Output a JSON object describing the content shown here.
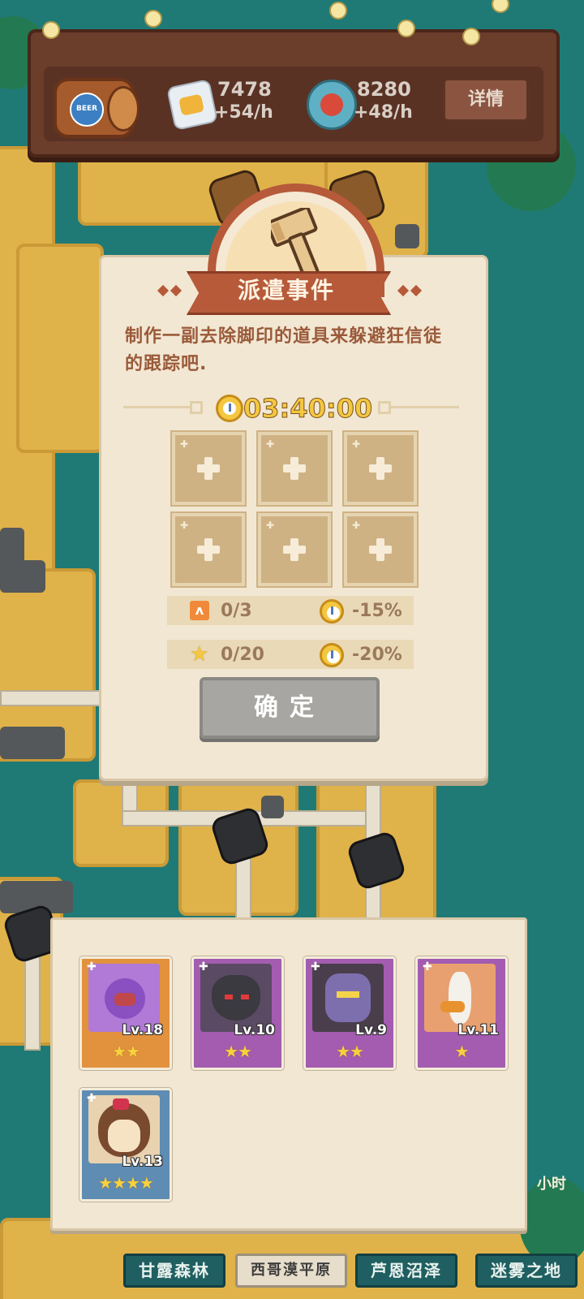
{
  "resources": {
    "beer_logo": "BEER",
    "items": [
      {
        "icon": "crisps-icon",
        "value": "7478",
        "rate": "+54/h"
      },
      {
        "icon": "bottle-cap-icon",
        "value": "8280",
        "rate": "+48/h"
      }
    ],
    "detail_label": "详情"
  },
  "dialog": {
    "title": "派遣事件",
    "description": "制作一副去除脚印的道具来躲避狂信徒的跟踪吧.",
    "timer": "03:40:00",
    "slots": 6,
    "requirements": [
      {
        "icon": "flag-icon",
        "count": "0/3",
        "bonus": "-15%"
      },
      {
        "icon": "star-icon",
        "count": "0/20",
        "bonus": "-20%"
      }
    ],
    "confirm_label": "确定"
  },
  "heroes": [
    {
      "level": "Lv.18",
      "stars": "★★",
      "color": "orange"
    },
    {
      "level": "Lv.10",
      "stars": "★★",
      "color": "purple"
    },
    {
      "level": "Lv.9",
      "stars": "★★",
      "color": "purple"
    },
    {
      "level": "Lv.11",
      "stars": "★",
      "color": "purple"
    },
    {
      "level": "Lv.13",
      "stars": "★★★★",
      "color": "blue"
    }
  ],
  "map": {
    "regions": [
      "甘露森林",
      "西哥漠平原",
      "芦恩沼泽",
      "迷雾之地"
    ],
    "side_hint": "小时"
  },
  "colors": {
    "accent": "#b65a3a",
    "panel": "#f2e7d3",
    "timer_gold": "#f4c740",
    "disabled_button": "#a8a6a2"
  }
}
